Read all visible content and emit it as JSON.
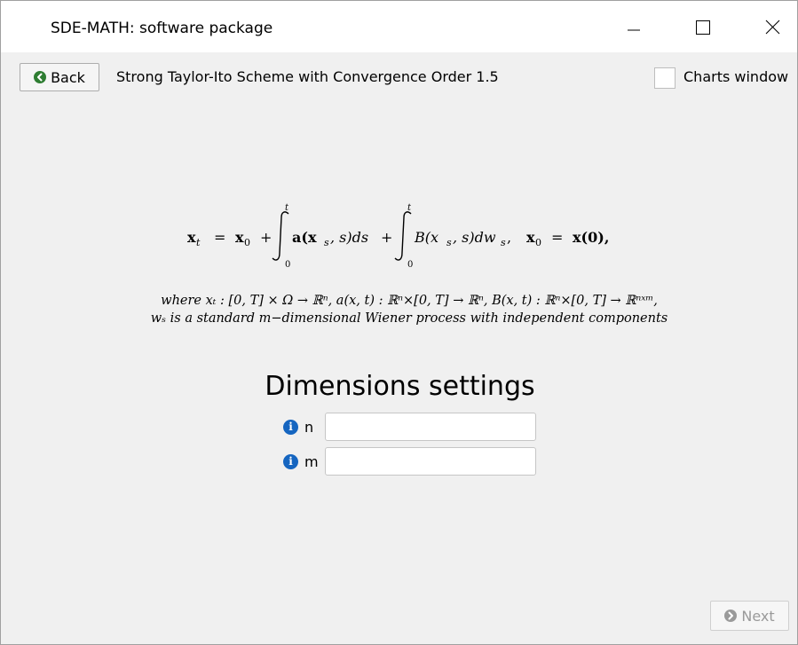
{
  "window": {
    "title": "SDE-MATH: software package"
  },
  "toolbar": {
    "back_label": "Back",
    "scheme_title": "Strong Taylor-Ito Scheme with Convergence Order 1.5",
    "charts_window_label": "Charts window",
    "charts_window_checked": false
  },
  "formula": {
    "lhs": "x",
    "lhs_sub": "t",
    "eq1": "=",
    "x0": "x",
    "x0_sub": "0",
    "plus1": "+",
    "int1_upper": "t",
    "int1_lower": "0",
    "int1_body": "a(x",
    "int1_body_sub": "s",
    "int1_body_rest": ", s)ds",
    "plus2": "+",
    "int2_upper": "t",
    "int2_lower": "0",
    "int2_body": "B(x",
    "int2_body_sub": "s",
    "int2_body_rest": ", s)dw",
    "int2_body_sub2": "s",
    "comma": ",",
    "init_lhs": "x",
    "init_lhs_sub": "0",
    "eq2": "=",
    "init_rhs": "x(0),"
  },
  "description": {
    "line1": "where xₜ : [0, T] × Ω → ℝⁿ, a(x, t) : ℝⁿ×[0, T] → ℝⁿ, B(x, t) : ℝⁿ×[0, T] → ℝⁿˣᵐ,",
    "line2": "wₛ is a standard m−dimensional Wiener process with independent components"
  },
  "dimensions": {
    "heading": "Dimensions settings",
    "fields": [
      {
        "label": "n",
        "value": "",
        "placeholder": ""
      },
      {
        "label": "m",
        "value": "",
        "placeholder": ""
      }
    ]
  },
  "footer": {
    "next_label": "Next"
  },
  "colors": {
    "info_icon": "#1565c0",
    "back_icon": "#2e7d32",
    "next_icon_disabled": "#9a9a9a"
  },
  "icons": {
    "back": "arrow-left-circle-icon",
    "next": "arrow-right-circle-icon",
    "info": "info-icon",
    "minimize": "minimize-icon",
    "maximize": "maximize-icon",
    "close": "close-icon"
  }
}
